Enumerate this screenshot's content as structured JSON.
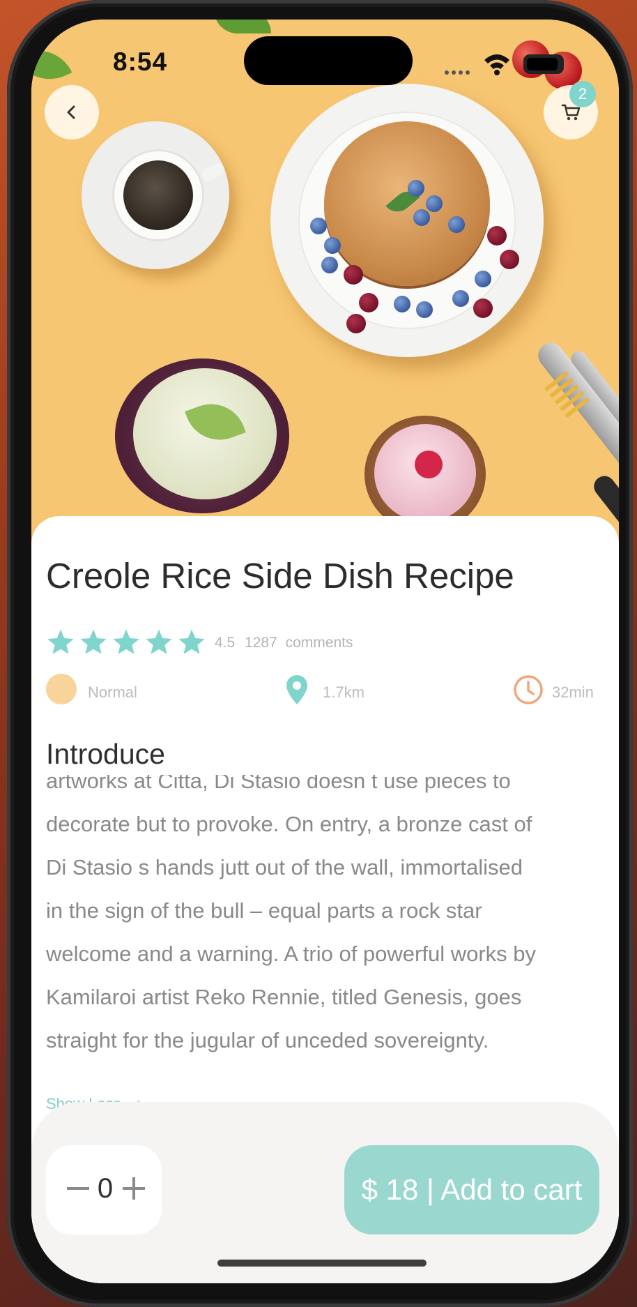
{
  "status_bar": {
    "time": "8:54"
  },
  "header": {
    "cart_badge_count": "2"
  },
  "product": {
    "title": "Creole Rice Side Dish Recipe",
    "rating_stars": 5,
    "rating_value": "4.5",
    "comments_count": "1287",
    "comments_label": "comments",
    "meta": {
      "difficulty": "Normal",
      "distance": "1.7km",
      "time": "32min"
    }
  },
  "introduce": {
    "heading": "Introduce",
    "lines": [
      "artworks at Citta, Di Stasio doesn t use pieces to",
      "decorate but to provoke. On entry, a bronze cast of",
      "Di Stasio s hands jutt out of the wall, immortalised",
      "in the sign of the bull – equal parts a rock star",
      "welcome and a warning. A trio of powerful works by",
      "Kamilaroi artist Reko Rennie, titled Genesis, goes",
      "straight for the jugular of unceded sovereignty."
    ],
    "toggle_label": "Show Less"
  },
  "cart": {
    "quantity": "0",
    "add_label": "$ 18 | Add to cart"
  },
  "colors": {
    "accent": "#7fd4cc",
    "cta": "#9ad8cf",
    "hero_bg": "#f7c672",
    "clock": "#f0a57c",
    "difficulty_dot": "#f8d49a"
  },
  "icons": {
    "back": "chevron-left-icon",
    "cart": "cart-icon",
    "star": "star-icon",
    "location": "location-pin-icon",
    "clock": "clock-icon",
    "minus": "minus-icon",
    "plus": "plus-icon"
  }
}
